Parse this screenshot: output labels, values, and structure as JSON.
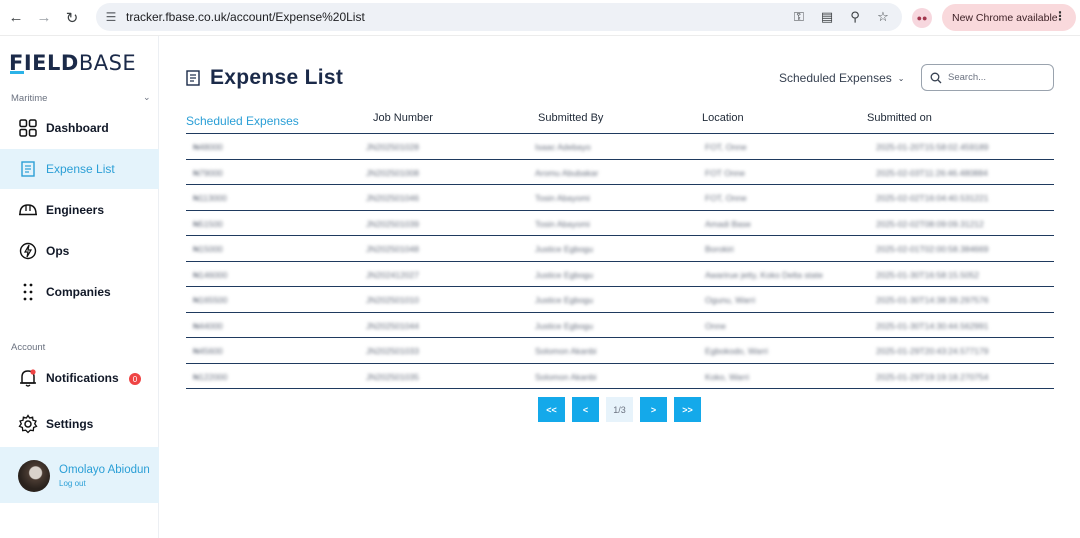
{
  "browser": {
    "url": "tracker.fbase.co.uk/account/Expense%20List",
    "new_chrome_label": "New Chrome available"
  },
  "sidebar": {
    "logo_bold": "FIELD",
    "logo_light": "BASE",
    "maritime_label": "Maritime",
    "account_label": "Account",
    "items": [
      {
        "label": "Dashboard",
        "icon": "dashboard-grid-icon"
      },
      {
        "label": "Expense List",
        "icon": "receipt-icon",
        "active": true
      },
      {
        "label": "Engineers",
        "icon": "hard-hat-icon"
      },
      {
        "label": "Ops",
        "icon": "ops-bolt-icon"
      },
      {
        "label": "Companies",
        "icon": "dots-grid-icon"
      }
    ],
    "account_items": [
      {
        "label": "Notifications",
        "icon": "bell-icon",
        "badge": "0"
      },
      {
        "label": "Settings",
        "icon": "gear-icon"
      }
    ],
    "profile": {
      "name": "Omolayo Abiodun",
      "logout": "Log out"
    }
  },
  "main": {
    "title": "Expense List",
    "filter_label": "Scheduled Expenses",
    "search_placeholder": "Search...",
    "columns": [
      "Scheduled Expenses",
      "Job Number",
      "Submitted By",
      "Location",
      "Submitted on"
    ],
    "rows": [
      [
        "₦48000",
        "JN202501028",
        "Isaac Adebayo",
        "FOT, Onne",
        "2025-01-20T15:58:02.459189"
      ],
      [
        "₦79000",
        "JN202501008",
        "Aromu Abubakar",
        "FOT Onne",
        "2025-02-03T11:26:46.480884"
      ],
      [
        "₦113000",
        "JN202501046",
        "Tosin Abayomi",
        "FOT, Onne",
        "2025-02-02T16:04:40.531221"
      ],
      [
        "₦51500",
        "JN202501039",
        "Tosin Abayomi",
        "Amadi Base",
        "2025-02-02T08:09:09.31212"
      ],
      [
        "₦15000",
        "JN202501048",
        "Justice Egbogu",
        "Borokiri",
        "2025-02-01T02:00:58.384669"
      ],
      [
        "₦146000",
        "JN202412027",
        "Justice Egbogu",
        "Awarirue jetty, Koko Delta state",
        "2025-01-30T16:58:15.5052"
      ],
      [
        "₦165500",
        "JN202501010",
        "Justice Egbogu",
        "Ogunu, Warri",
        "2025-01-30T14:38:39.297576"
      ],
      [
        "₦44000",
        "JN202501044",
        "Justice Egbogu",
        "Onne",
        "2025-01-30T14:30:44.562991"
      ],
      [
        "₦45600",
        "JN202501033",
        "Solomon Akanbi",
        "Egbokodo, Warri",
        "2025-01-29T20:43:24.577179"
      ],
      [
        "₦122000",
        "JN202501035",
        "Solomon Akanbi",
        "Koko, Warri",
        "2025-01-29T19:19:18.270754"
      ]
    ],
    "pagination": {
      "first": "<<",
      "prev": "<",
      "current": "1/3",
      "next": ">",
      "last": ">>"
    }
  }
}
